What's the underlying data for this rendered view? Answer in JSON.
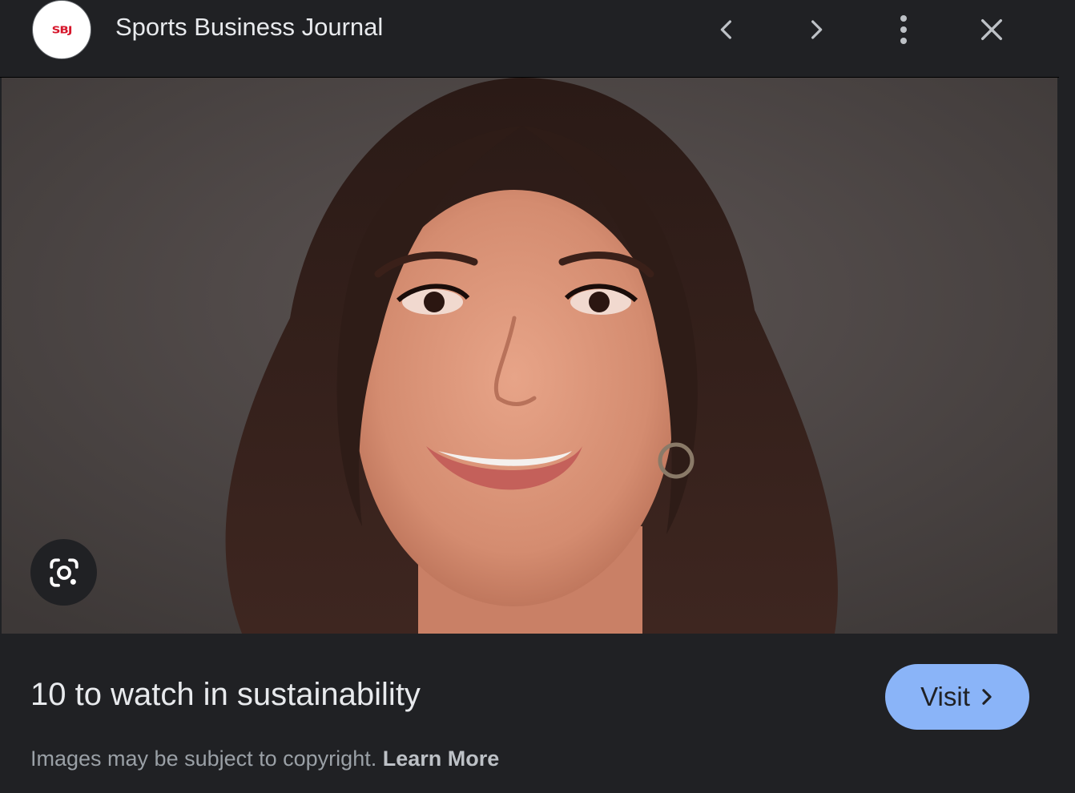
{
  "header": {
    "logo_text": "SBJ",
    "source_title": "Sports Business Journal",
    "icons": {
      "prev": "chevron-left-icon",
      "next": "chevron-right-icon",
      "more": "more-vert-icon",
      "close": "close-icon"
    }
  },
  "image": {
    "lens_icon": "google-lens-icon"
  },
  "footer": {
    "caption": "10 to watch in sustainability",
    "visit_label": "Visit",
    "copyright_text": "Images may be subject to copyright.",
    "learn_more_label": "Learn More"
  },
  "colors": {
    "background": "#202124",
    "accent": "#8ab4f8",
    "logo_red": "#d6162b"
  }
}
